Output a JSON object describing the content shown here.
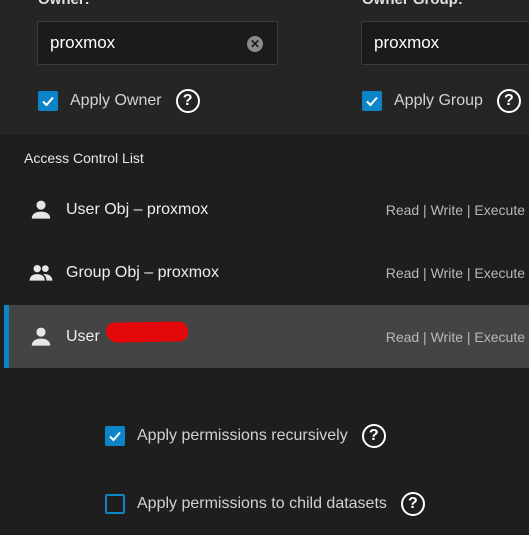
{
  "owner": {
    "label": "Owner:",
    "value": "proxmox",
    "apply_label": "Apply Owner",
    "apply_checked": true
  },
  "owner_group": {
    "label": "Owner Group:",
    "value": "proxmox",
    "apply_label": "Apply Group",
    "apply_checked": true
  },
  "acl": {
    "title": "Access Control List",
    "items": [
      {
        "icon": "user-icon",
        "name": "User Obj – proxmox",
        "perms": "Read | Write | Execute",
        "selected": false
      },
      {
        "icon": "group-icon",
        "name": "Group Obj – proxmox",
        "perms": "Read | Write | Execute",
        "selected": false
      },
      {
        "icon": "user-icon",
        "name": "User",
        "perms": "Read | Write | Execute",
        "selected": true
      }
    ]
  },
  "options": {
    "recursive_label": "Apply permissions recursively",
    "recursive_checked": true,
    "child_label": "Apply permissions to child datasets",
    "child_checked": false
  },
  "colors": {
    "accent": "#0e84c8",
    "redaction": "#e4080a"
  }
}
